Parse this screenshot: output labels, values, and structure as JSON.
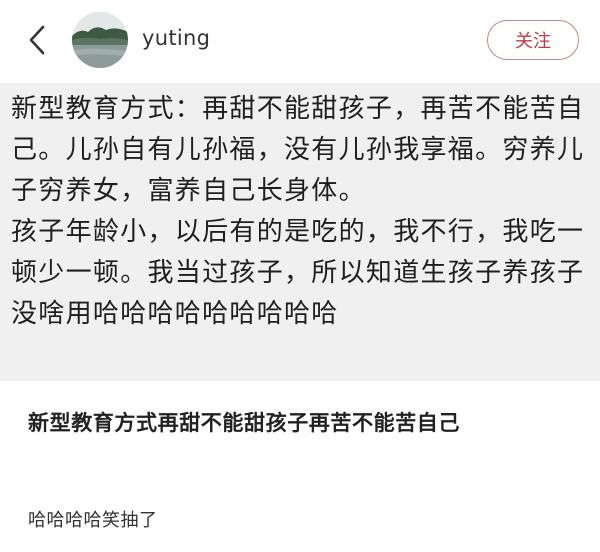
{
  "header": {
    "back_icon": "chevron-left-icon",
    "avatar_icon": "avatar-landscape-icon",
    "username": "yuting",
    "follow_label": "关注",
    "follow_color": "#c23a48"
  },
  "quote": {
    "paragraphs": [
      "新型教育方式：再甜不能甜孩子，再苦不能苦自己。儿孙自有儿孙福，没有儿孙我享福。穷养儿子穷养女，富养自己长身体。",
      "孩子年龄小，以后有的是吃的，我不行，我吃一顿少一顿。我当过孩子，所以知道生孩子养孩子没啥用哈哈哈哈哈哈哈哈哈"
    ],
    "background": "#f0f0f0"
  },
  "post": {
    "title": "新型教育方式再甜不能甜孩子再苦不能苦自己",
    "body": "哈哈哈哈笑抽了"
  }
}
